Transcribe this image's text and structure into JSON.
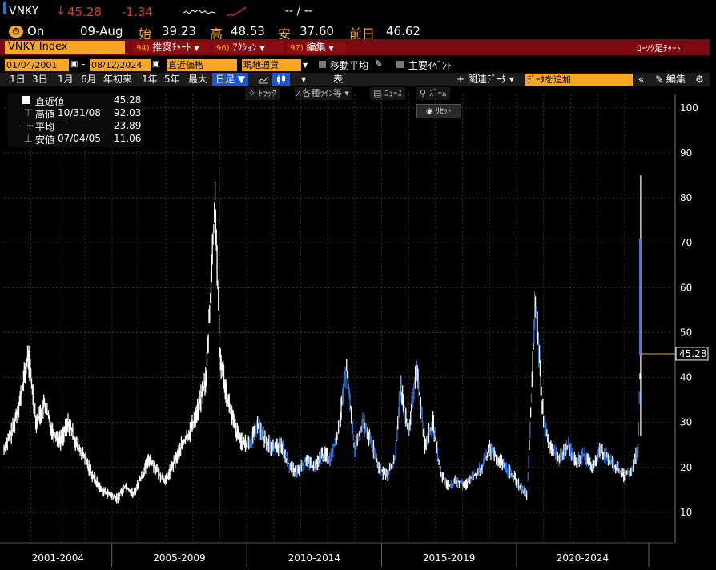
{
  "quote": {
    "ticker": "VNKY",
    "arrow": "↓",
    "last": "45.28",
    "change": "-1.34",
    "bid_ask": "-- / --",
    "status": "On",
    "date": "09-Aug",
    "open_label": "始",
    "open": "39.23",
    "high_label": "高",
    "high": "48.53",
    "low_label": "安",
    "low": "37.60",
    "prev_label": "前日",
    "prev": "46.62"
  },
  "toolbar": {
    "security": "VNKY Index",
    "menus": [
      {
        "num": "94)",
        "label": "推奨ﾁｬｰﾄ"
      },
      {
        "num": "96)",
        "label": "ｱｸｼｮﾝ"
      },
      {
        "num": "97)",
        "label": "編集"
      }
    ],
    "chart_type": "ﾛｰｿｸ足ﾁｬｰﾄ"
  },
  "params": {
    "start_date": "01/04/2001",
    "end_date": "08/12/2024",
    "price_field": "直近価格",
    "currency": "現地通貨",
    "moving_avg": "移動平均",
    "key_events": "主要ｲﾍﾞﾝﾄ"
  },
  "ranges": {
    "items": [
      "1日",
      "3日",
      "1月",
      "6月",
      "年初来",
      "1年",
      "5年",
      "最大"
    ],
    "period": "日足",
    "table": "表",
    "related": "関連ﾃﾞｰﾀ",
    "add_data": "ﾃﾞｰﾀを追加",
    "edit": "編集"
  },
  "tools": {
    "track": "ﾄﾗｯｸ",
    "lines": "各種ﾗｲﾝ等",
    "news": "ﾆｭｰｽ",
    "zoom": "ｽﾞｰﾑ",
    "reset": "ﾘｾｯﾄ"
  },
  "legend": {
    "last_label": "直近値",
    "last_value": "45.28",
    "high_label": "高値",
    "high_date": "10/31/08",
    "high_value": "92.03",
    "avg_label": "平均",
    "avg_value": "23.89",
    "low_label": "安値",
    "low_date": "07/04/05",
    "low_value": "11.06"
  },
  "colors": {
    "accent": "#f5a623",
    "maroon": "#7a0a0f",
    "negative": "#e23b3b",
    "candle_up": "#ffffff",
    "candle_down": "#2f6fe0"
  },
  "chart_data": {
    "type": "line",
    "title": "",
    "xlabel": "",
    "ylabel": "",
    "ylim": [
      5,
      103
    ],
    "y_ticks": [
      10,
      20,
      30,
      40,
      50,
      60,
      70,
      80,
      90,
      100
    ],
    "x_periods": [
      "2001-2004",
      "2005-2009",
      "2010-2014",
      "2015-2019",
      "2020-2024"
    ],
    "last_price_label": "45.28",
    "series": [
      {
        "x": [
          2001.0,
          2001.3,
          2001.6,
          2001.9,
          2002.2,
          2002.5,
          2002.8,
          2003.1,
          2003.4,
          2003.7,
          2004.0,
          2004.3,
          2004.6,
          2004.9,
          2005.2,
          2005.5,
          2005.8,
          2006.1,
          2006.4,
          2006.7,
          2007.0,
          2007.3,
          2007.6,
          2007.9,
          2008.2,
          2008.5,
          2008.83,
          2009.0,
          2009.3,
          2009.6,
          2009.9,
          2010.2,
          2010.4,
          2010.7,
          2011.0,
          2011.3,
          2011.6,
          2011.9,
          2012.2,
          2012.5,
          2012.8,
          2013.1,
          2013.4,
          2013.7,
          2014.0,
          2014.3,
          2014.6,
          2014.9,
          2015.2,
          2015.5,
          2015.7,
          2016.0,
          2016.3,
          2016.6,
          2016.9,
          2017.2,
          2017.5,
          2017.8,
          2018.1,
          2018.4,
          2018.7,
          2019.0,
          2019.3,
          2019.6,
          2019.9,
          2020.2,
          2020.4,
          2020.7,
          2021.0,
          2021.3,
          2021.6,
          2021.9,
          2022.2,
          2022.5,
          2022.8,
          2023.1,
          2023.4,
          2023.7,
          2024.0,
          2024.3,
          2024.5,
          2024.6
        ],
        "values": [
          24,
          28,
          35,
          45,
          30,
          34,
          28,
          26,
          30,
          25,
          22,
          18,
          15,
          14,
          13,
          16,
          14,
          18,
          22,
          19,
          17,
          21,
          25,
          28,
          33,
          40,
          80,
          45,
          35,
          28,
          25,
          26,
          30,
          26,
          24,
          25,
          20,
          19,
          22,
          20,
          23,
          22,
          28,
          42,
          24,
          30,
          26,
          20,
          18,
          22,
          38,
          28,
          42,
          25,
          30,
          18,
          16,
          17,
          16,
          18,
          20,
          24,
          22,
          20,
          18,
          15,
          14,
          58,
          30,
          24,
          22,
          25,
          21,
          23,
          20,
          24,
          22,
          20,
          18,
          20,
          24,
          45
        ]
      }
    ]
  }
}
